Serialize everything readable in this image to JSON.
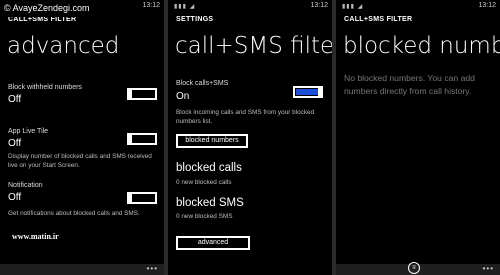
{
  "watermarks": {
    "top": "© AvayeZendegi.com",
    "bottom": "www.matin.ir"
  },
  "screen1": {
    "time": "13:12",
    "app_title": "CALL+SMS FILTER",
    "page_title": "advanced",
    "withheld": {
      "label": "Block withheld numbers",
      "value": "Off"
    },
    "live_tile": {
      "label": "App Live Tile",
      "value": "Off",
      "description": "Display number of blocked calls and SMS received live on your Start Screen."
    },
    "notification": {
      "label": "Notification",
      "value": "Off",
      "description": "Get notifications about blocked calls and SMS."
    },
    "menu_dots": "•••"
  },
  "screen2": {
    "time": "13:12",
    "app_title": "SETTINGS",
    "page_title": "call+SMS filter",
    "block": {
      "label": "Block calls+SMS",
      "value": "On",
      "description": "Block incoming calls and SMS from your blocked numbers list."
    },
    "blocked_numbers_button": "blocked numbers",
    "blocked_calls": {
      "title": "blocked calls",
      "count_text": "0 new blocked calls"
    },
    "blocked_sms": {
      "title": "blocked SMS",
      "count_text": "0 new blocked SMS"
    },
    "advanced_button": "advanced",
    "accent_color": "#1b4fd6"
  },
  "screen3": {
    "time": "13:12",
    "app_title": "CALL+SMS FILTER",
    "page_title": "blocked numbers",
    "empty_text": "No blocked numbers. You can add numbers directly from call history.",
    "list_icon": "list-icon",
    "menu_dots": "•••"
  }
}
